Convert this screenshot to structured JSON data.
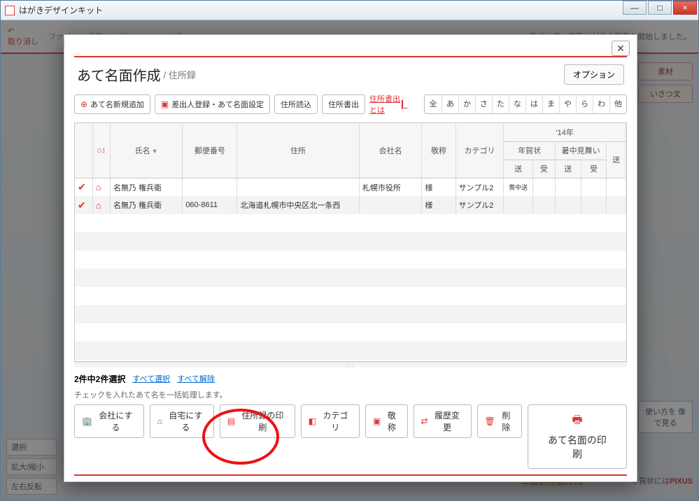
{
  "window": {
    "title": "はがきデザインキット",
    "minimize": "—",
    "maximize": "□",
    "close": "×"
  },
  "bg": {
    "undo": "取り消し",
    "menu": [
      "ファイル",
      "編集",
      "オプション",
      "ヘルプ"
    ],
    "news_label": "News",
    "news_arrow": "▶",
    "news_text": "平成26年　年賀はがきの販売を開始しました。",
    "right_chips": [
      "素材",
      "いさつ文"
    ],
    "usage": "使い方を\n像で見る",
    "special": "\"年賀状特集2015\"",
    "pixus_pre": "年賀状には",
    "pixus_brand": "PIXUS",
    "nengajo": "年賀状",
    "left_buttons": [
      "選択",
      "拡大/縮小",
      "左右反転"
    ]
  },
  "modal": {
    "close": "✕",
    "title": "あて名面作成",
    "sub": " / 住所録",
    "option": "オプション",
    "toolbar": {
      "add": "あて名新規追加",
      "sender": "差出人登録・あて名面設定",
      "import": "住所読込",
      "export": "住所書出",
      "about_export": "住所書出\nとは"
    },
    "kana": [
      "全",
      "あ",
      "か",
      "さ",
      "た",
      "な",
      "は",
      "ま",
      "や",
      "ら",
      "わ",
      "他"
    ],
    "table": {
      "headers": {
        "check": "",
        "home": "",
        "name": "氏名",
        "postal": "郵便番号",
        "address": "住所",
        "company": "会社名",
        "honorific": "敬称",
        "category": "カテゴリ",
        "year": "'14年",
        "nenga": "年賀状",
        "shochu": "暑中見舞い",
        "send": "送",
        "recv": "受"
      },
      "rows": [
        {
          "checked": true,
          "home": true,
          "name": "名無乃 権兵衛",
          "postal": "",
          "address": "",
          "company": "札幌市役所",
          "honorific": "様",
          "category": "サンプル2",
          "status": "喪中送"
        },
        {
          "checked": true,
          "home": true,
          "name": "名無乃 権兵衛",
          "postal": "060-8611",
          "address": "北海道札幌市中央区北一条西",
          "company": "",
          "honorific": "様",
          "category": "サンプル2",
          "status": ""
        }
      ]
    },
    "footer": {
      "selection": "2件中2件選択",
      "sel_all": "すべて選択",
      "sel_none": "すべて解除",
      "hint": "チェックを入れたあて名を一括処理します。",
      "actions": {
        "to_company": "会社にする",
        "to_home": "自宅にする",
        "print_list": "住所録の印刷",
        "category": "カテゴリ",
        "honorific": "敬称",
        "history": "履歴変更",
        "delete": "削除"
      },
      "print": "あて名面の印刷"
    }
  }
}
